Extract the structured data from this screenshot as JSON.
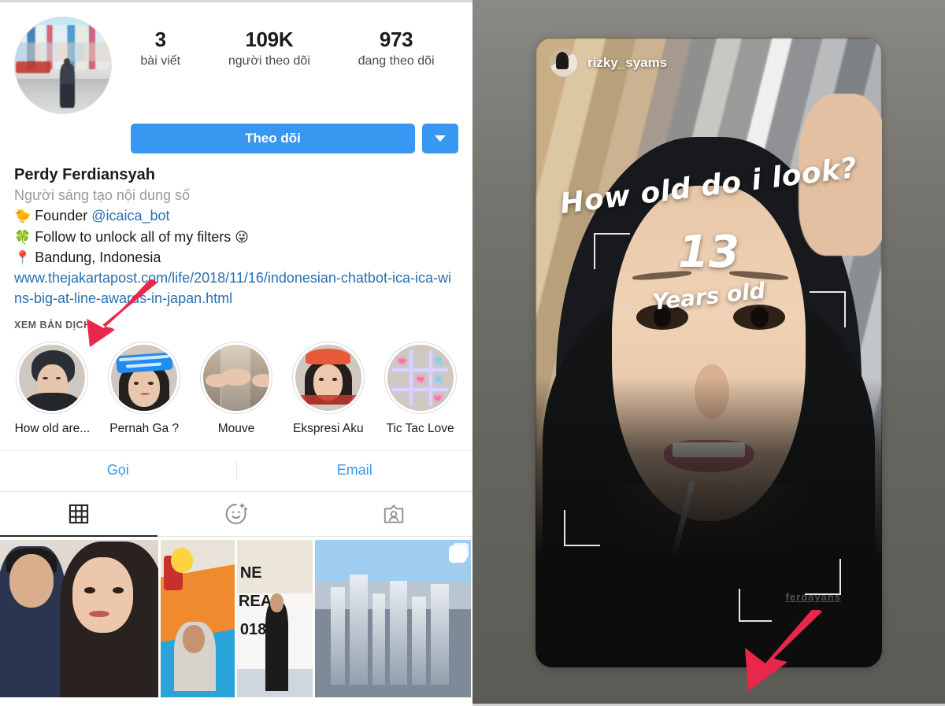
{
  "profile": {
    "stats": [
      {
        "num": "3",
        "label": "bài viết"
      },
      {
        "num": "109K",
        "label": "người theo dõi"
      },
      {
        "num": "973",
        "label": "đang theo dõi"
      }
    ],
    "follow_button": "Theo dõi",
    "dropdown_icon": "chevron-down-icon",
    "full_name": "Perdy Ferdiansyah",
    "category": "Người sáng tạo nội dung số",
    "bio_lines": [
      {
        "emoji": "🐤",
        "text": "Founder ",
        "handle": "@icaica_bot",
        "trailing_emoji": ""
      },
      {
        "emoji": "🍀",
        "text": "Follow to unlock all of my filters ",
        "handle": "",
        "trailing_emoji": "😜"
      },
      {
        "emoji": "📍",
        "text": "Bandung, Indonesia",
        "handle": "",
        "trailing_emoji": ""
      }
    ],
    "website": "www.thejakartapost.com/life/2018/11/16/indonesian-chatbot-ica-ica-wins-big-at-line-awards-in-japan.html",
    "see_translation": "XEM BẢN DỊCH",
    "highlights": [
      {
        "label": "How old are...",
        "thumb": "hijab-girl-thumb"
      },
      {
        "label": "Pernah Ga ?",
        "thumb": "girl-blue-sticker-thumb"
      },
      {
        "label": "Mouve",
        "thumb": "three-panel-collage-thumb"
      },
      {
        "label": "Ekspresi Aku",
        "thumb": "girl-red-cap-thumb"
      },
      {
        "label": "Tic Tac Love",
        "thumb": "tic-tac-toe-neon-thumb"
      }
    ],
    "contact": {
      "call": "Gọi",
      "email": "Email"
    },
    "tabs": [
      {
        "name": "grid-tab",
        "icon": "grid-icon",
        "active": true
      },
      {
        "name": "effects-tab",
        "icon": "smiley-sparkle-icon",
        "active": false
      },
      {
        "name": "tagged-tab",
        "icon": "tagged-person-icon",
        "active": false
      }
    ],
    "posts": [
      {
        "name": "post-couple-selfie"
      },
      {
        "name": "post-kids-pool"
      },
      {
        "name": "post-line-creative-2018"
      },
      {
        "name": "post-city-skyline",
        "badge": "multi-photo-icon"
      }
    ],
    "annotation_arrow": {
      "name": "red-arrow-pointing-to-first-highlight",
      "color": "#e8274b"
    }
  },
  "story": {
    "username": "rizky_syams",
    "avatar": "story-author-avatar",
    "ar_filter": {
      "question": "How old do i look?",
      "age": "13",
      "unit": "Years old"
    },
    "watermark": "ferdayans",
    "annotation_arrow": {
      "name": "red-arrow-pointing-to-story-bottom",
      "color": "#e8274b"
    }
  },
  "colors": {
    "instagram_blue": "#3897f0",
    "link_blue": "#2a6fb0",
    "arrow_red": "#e8274b",
    "story_backdrop_gray": "#6b6a68",
    "text_dark": "#1b1b1b",
    "text_muted": "#9a9a9a"
  }
}
